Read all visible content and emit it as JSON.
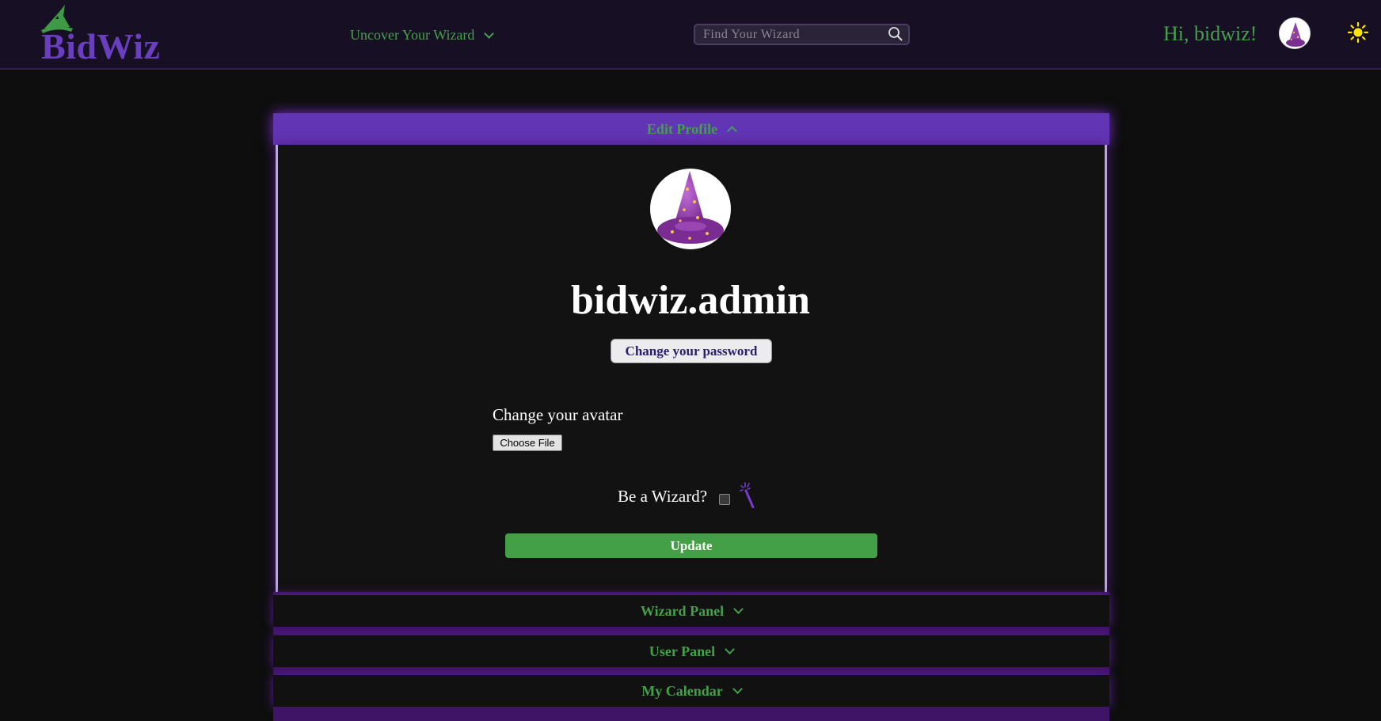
{
  "header": {
    "logo_text": "BidWiz",
    "nav_dropdown_label": "Uncover Your Wizard",
    "search_placeholder": "Find Your Wizard",
    "greeting": "Hi, bidwiz!"
  },
  "colors": {
    "accent_purple": "#6235b5",
    "accent_green": "#45a04a",
    "header_bg": "#170f24",
    "page_bg": "#0e0e0e"
  },
  "panels": [
    {
      "title": "Edit Profile",
      "expanded": true,
      "content": {
        "username": "bidwiz.admin",
        "change_password_label": "Change your password",
        "avatar_label": "Change your avatar",
        "file_button_label": "Choose File",
        "wizard_label": "Be a Wizard?",
        "wizard_checked": false,
        "update_label": "Update"
      }
    },
    {
      "title": "Wizard Panel",
      "expanded": false
    },
    {
      "title": "User Panel",
      "expanded": false
    },
    {
      "title": "My Calendar",
      "expanded": false
    }
  ],
  "icons": [
    "wizard-hat-logo-icon",
    "chevron-down-icon",
    "search-icon",
    "avatar",
    "sun-icon",
    "chevron-up-icon",
    "magic-wand-icon"
  ]
}
